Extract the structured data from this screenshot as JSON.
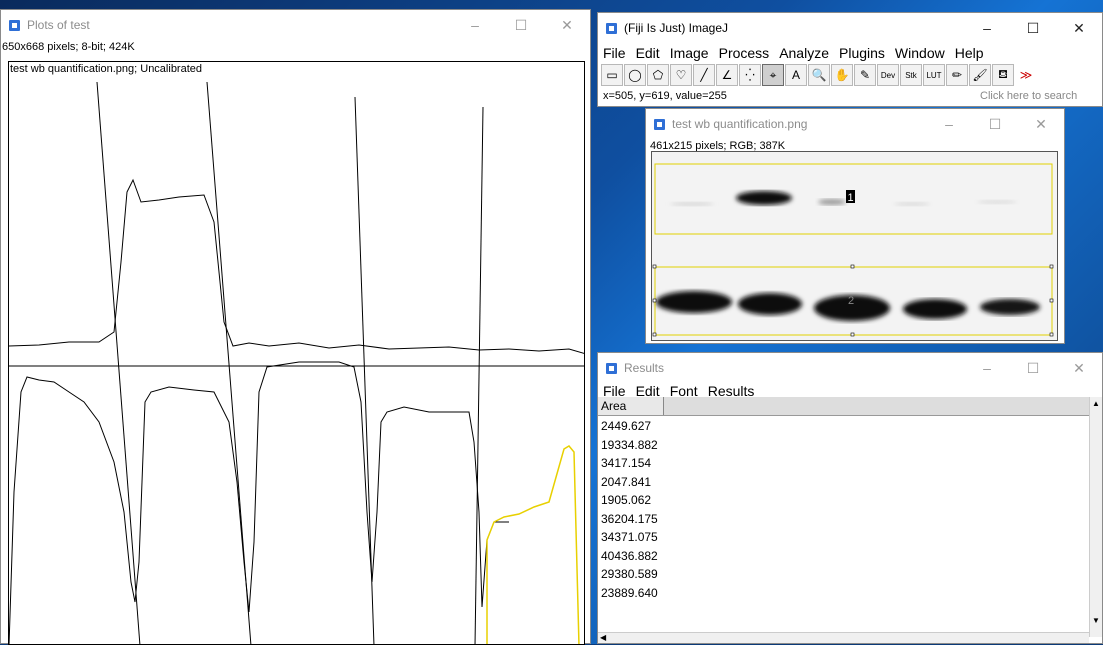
{
  "plots_window": {
    "title": "Plots of test",
    "info": "650x668 pixels; 8-bit; 424K",
    "subtitle": "test wb quantification.png; Uncalibrated"
  },
  "imagej_window": {
    "title": "(Fiji Is Just) ImageJ",
    "menu": [
      "File",
      "Edit",
      "Image",
      "Process",
      "Analyze",
      "Plugins",
      "Window",
      "Help"
    ],
    "tools": [
      {
        "name": "rectangle-tool-icon",
        "glyph": "▭"
      },
      {
        "name": "oval-tool-icon",
        "glyph": "◯"
      },
      {
        "name": "polygon-tool-icon",
        "glyph": "⬠"
      },
      {
        "name": "freehand-tool-icon",
        "glyph": "♡"
      },
      {
        "name": "line-tool-icon",
        "glyph": "╱"
      },
      {
        "name": "angle-tool-icon",
        "glyph": "∠"
      },
      {
        "name": "point-tool-icon",
        "glyph": "⁛"
      },
      {
        "name": "wand-tool-icon",
        "glyph": "⌖"
      },
      {
        "name": "text-tool-icon",
        "glyph": "A"
      },
      {
        "name": "magnifier-tool-icon",
        "glyph": "🔍"
      },
      {
        "name": "hand-tool-icon",
        "glyph": "✋"
      },
      {
        "name": "color-picker-tool-icon",
        "glyph": "✎"
      },
      {
        "name": "dev-tool-icon",
        "glyph": "Dev"
      },
      {
        "name": "stk-tool-icon",
        "glyph": "Stk"
      },
      {
        "name": "lut-tool-icon",
        "glyph": "LUT"
      },
      {
        "name": "pencil-tool-icon",
        "glyph": "✏"
      },
      {
        "name": "brush-tool-icon",
        "glyph": "🖌"
      },
      {
        "name": "flood-fill-tool-icon",
        "glyph": "⛾"
      },
      {
        "name": "more-tools-icon",
        "glyph": "≫"
      }
    ],
    "status": "x=505, y=619, value=255",
    "search_placeholder": "Click here to search"
  },
  "image_window": {
    "title": "test wb quantification.png",
    "info": "461x215 pixels; RGB; 387K",
    "roi_labels": [
      "1",
      "2"
    ]
  },
  "results_window": {
    "title": "Results",
    "menu": [
      "File",
      "Edit",
      "Font",
      "Results"
    ],
    "column_header": "Area",
    "rows": [
      "2449.627",
      "19334.882",
      "3417.154",
      "2047.841",
      "1905.062",
      "36204.175",
      "34371.075",
      "40436.882",
      "29380.589",
      "23889.640"
    ]
  },
  "window_controls": {
    "minimize": "–",
    "maximize": "☐",
    "close": "✕"
  }
}
